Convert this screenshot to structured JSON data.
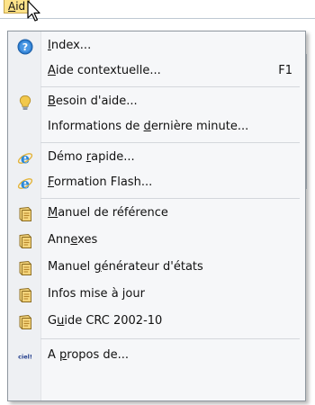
{
  "menubar": {
    "title_first": "A",
    "title_rest": "id"
  },
  "menu": {
    "items": [
      {
        "pre": "",
        "acc": "I",
        "post": "ndex...",
        "icon": "help-circle-icon"
      },
      {
        "pre": "",
        "acc": "A",
        "post": "ide contextuelle...",
        "shortcut": "F1"
      },
      {
        "pre": "",
        "acc": "B",
        "post": "esoin d'aide...",
        "icon": "lightbulb-icon"
      },
      {
        "pre": "Informations de ",
        "acc": "d",
        "post": "ernière minute..."
      },
      {
        "pre": "Démo ",
        "acc": "r",
        "post": "apide...",
        "icon": "internet-explorer-icon"
      },
      {
        "pre": "",
        "acc": "F",
        "post": "ormation Flash...",
        "icon": "internet-explorer-icon"
      },
      {
        "pre": "",
        "acc": "M",
        "post": "anuel de référence",
        "icon": "manual-icon"
      },
      {
        "pre": "Ann",
        "acc": "e",
        "post": "xes",
        "icon": "manual-icon"
      },
      {
        "pre": "Manuel ",
        "acc": "g",
        "post": "énérateur d'états",
        "icon": "manual-icon"
      },
      {
        "pre": "Infos mise à ",
        "acc": "j",
        "post": "our",
        "icon": "manual-icon"
      },
      {
        "pre": "G",
        "acc": "u",
        "post": "ide CRC 2002-10",
        "icon": "manual-icon"
      },
      {
        "pre": "A ",
        "acc": "p",
        "post": "ropos de...",
        "icon": "ciel-logo-icon",
        "logo_text": "ciel!"
      }
    ]
  },
  "colors": {
    "menu_bg": "#f6f7f9",
    "highlight": "#fde38a",
    "help_blue": "#2f7fd1",
    "bulb_yellow": "#f2c84b",
    "ie_blue": "#2a88d8"
  }
}
